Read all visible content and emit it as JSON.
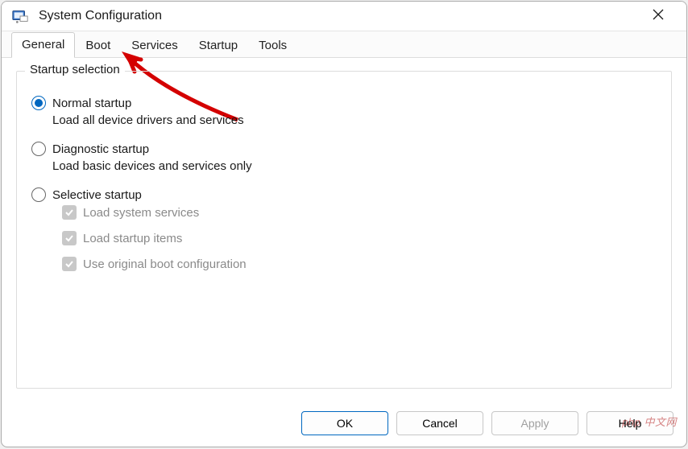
{
  "window": {
    "title": "System Configuration"
  },
  "tabs": [
    {
      "label": "General",
      "active": true
    },
    {
      "label": "Boot",
      "active": false
    },
    {
      "label": "Services",
      "active": false
    },
    {
      "label": "Startup",
      "active": false
    },
    {
      "label": "Tools",
      "active": false
    }
  ],
  "group": {
    "title": "Startup selection",
    "options": [
      {
        "label": "Normal startup",
        "desc": "Load all device drivers and services",
        "selected": true
      },
      {
        "label": "Diagnostic startup",
        "desc": "Load basic devices and services only",
        "selected": false
      },
      {
        "label": "Selective startup",
        "desc": "",
        "selected": false
      }
    ],
    "checks": [
      {
        "label": "Load system services",
        "checked": true
      },
      {
        "label": "Load startup items",
        "checked": true
      },
      {
        "label": "Use original boot configuration",
        "checked": true
      }
    ]
  },
  "buttons": {
    "ok": "OK",
    "cancel": "Cancel",
    "apply": "Apply",
    "help": "Help"
  },
  "watermark": "php 中文网"
}
